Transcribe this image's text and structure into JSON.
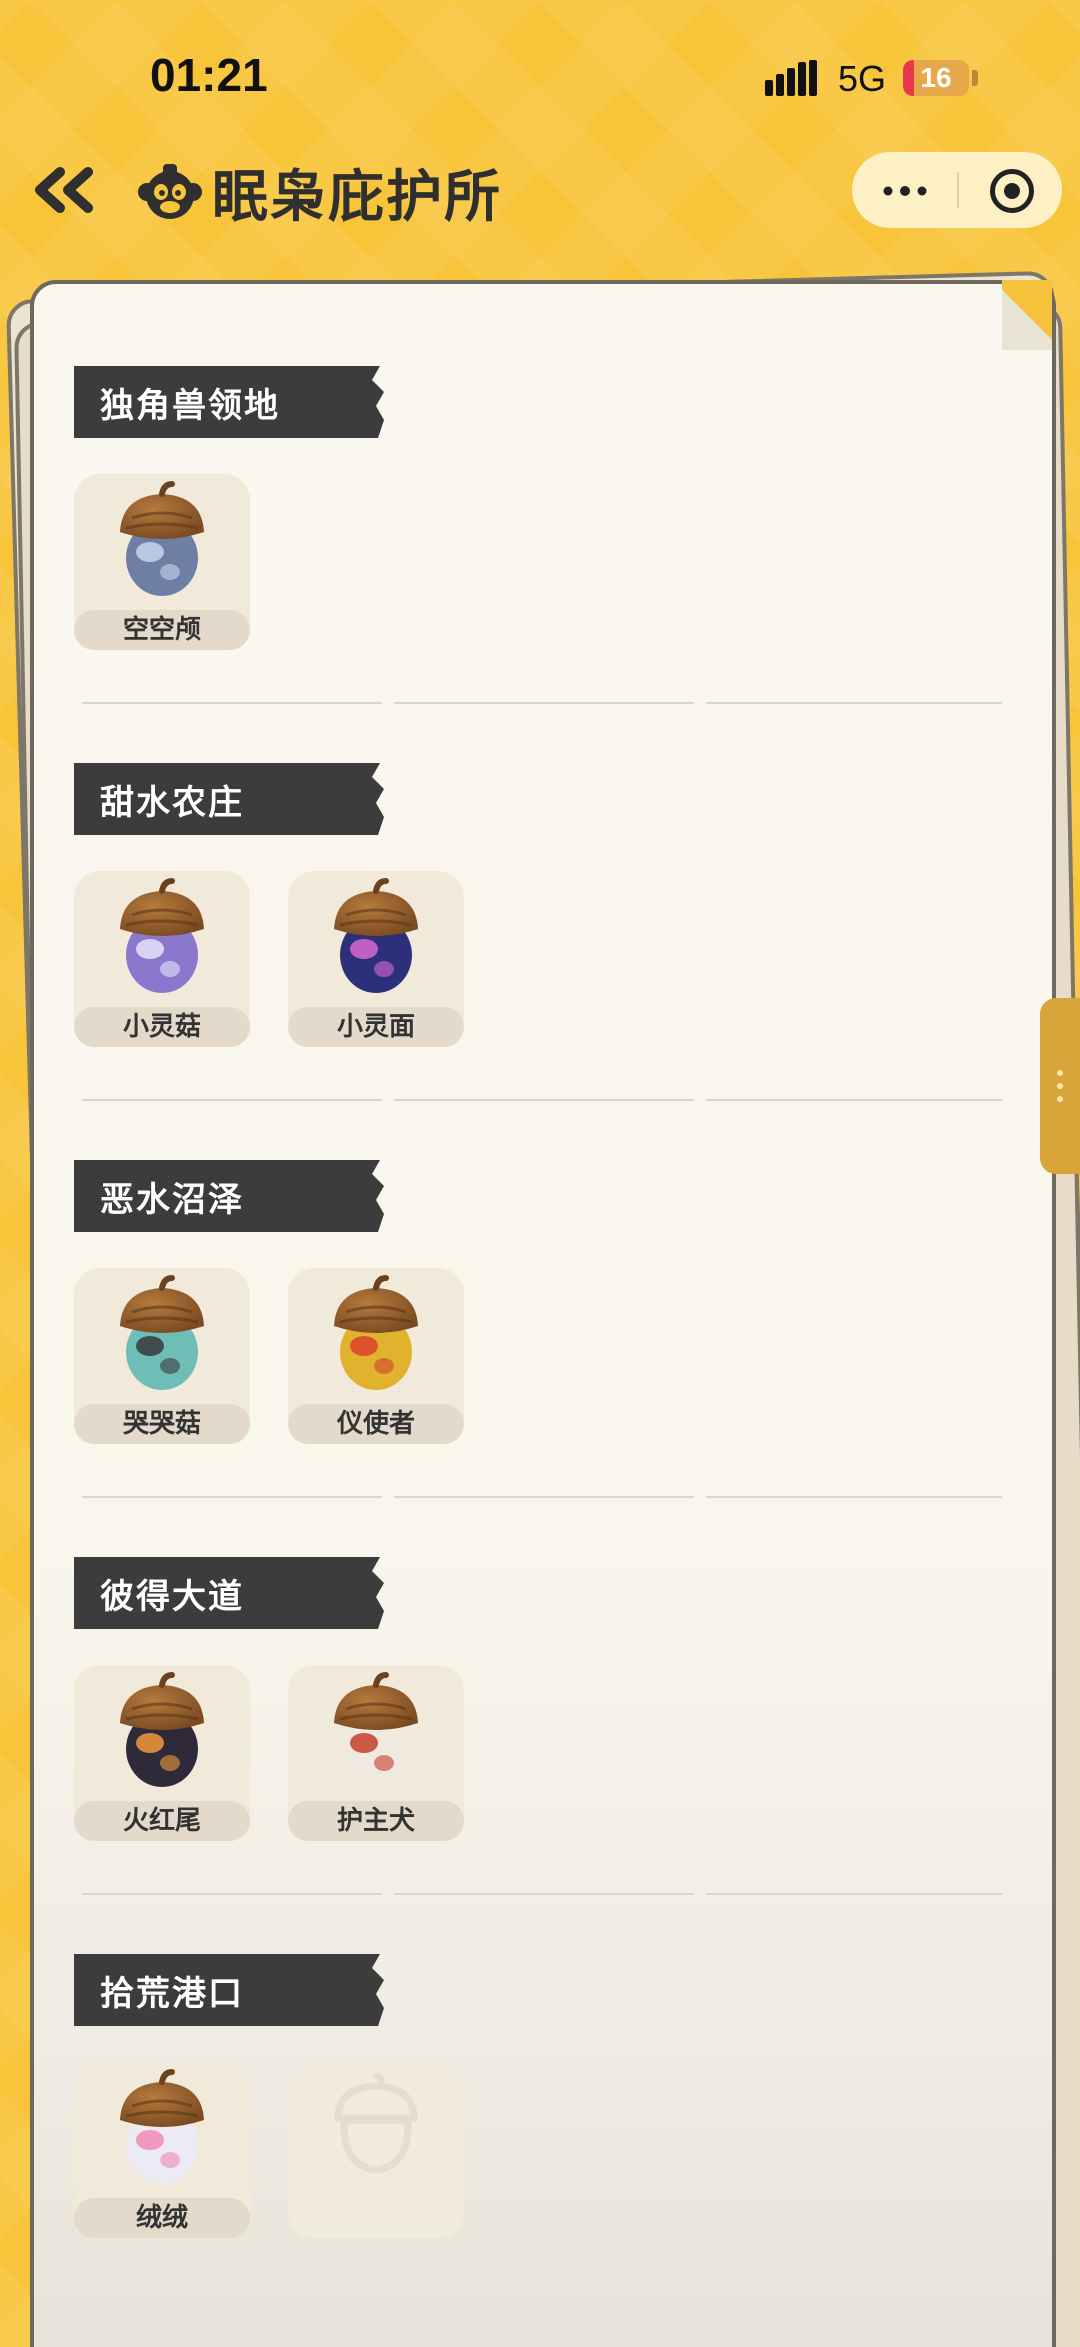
{
  "status_bar": {
    "time": "01:21",
    "network": "5G",
    "battery_level": "16",
    "battery_fraction": 0.16,
    "battery_color": "#e8384a"
  },
  "nav": {
    "back_icon": "double-chevron-left-icon",
    "logo_icon": "monkey-face-icon",
    "title": "眠枭庇护所",
    "more_icon": "more-dots-icon",
    "close_icon": "target-circle-icon"
  },
  "colors": {
    "background": "#f8c53a",
    "paper": "#faf7ee",
    "banner": "#3c3c3c",
    "slot": "#f1e9d9"
  },
  "sections": [
    {
      "title": "独角兽领地",
      "creatures": [
        {
          "name": "空空颅",
          "icon": "acorn-visor-icon",
          "body": "#6d7fa3",
          "accent": "#c6d3ef"
        }
      ]
    },
    {
      "title": "甜水农庄",
      "creatures": [
        {
          "name": "小灵菇",
          "icon": "acorn-swirl-icon",
          "body": "#8a78cf",
          "accent": "#e7e2fa"
        },
        {
          "name": "小灵面",
          "icon": "acorn-galaxy-icon",
          "body": "#2d2f7a",
          "accent": "#d86ad0"
        }
      ]
    },
    {
      "title": "恶水沼泽",
      "creatures": [
        {
          "name": "哭哭菇",
          "icon": "acorn-teal-icon",
          "body": "#6fbdb7",
          "accent": "#3a3a3a"
        },
        {
          "name": "仪使者",
          "icon": "acorn-flame-icon",
          "body": "#e0b22e",
          "accent": "#d9412b"
        }
      ]
    },
    {
      "title": "彼得大道",
      "creatures": [
        {
          "name": "火红尾",
          "icon": "acorn-fire-swirl-icon",
          "body": "#2f2a3a",
          "accent": "#f09a3a"
        },
        {
          "name": "护主犬",
          "icon": "acorn-red-white-icon",
          "body": "#efe9df",
          "accent": "#c4402c"
        }
      ]
    },
    {
      "title": "拾荒港口",
      "creatures": [
        {
          "name": "绒绒",
          "icon": "acorn-sparkle-icon",
          "body": "#ecebf3",
          "accent": "#f08bb4"
        },
        {
          "name": "",
          "icon": "acorn-outline-locked-icon",
          "locked": true
        }
      ]
    }
  ]
}
